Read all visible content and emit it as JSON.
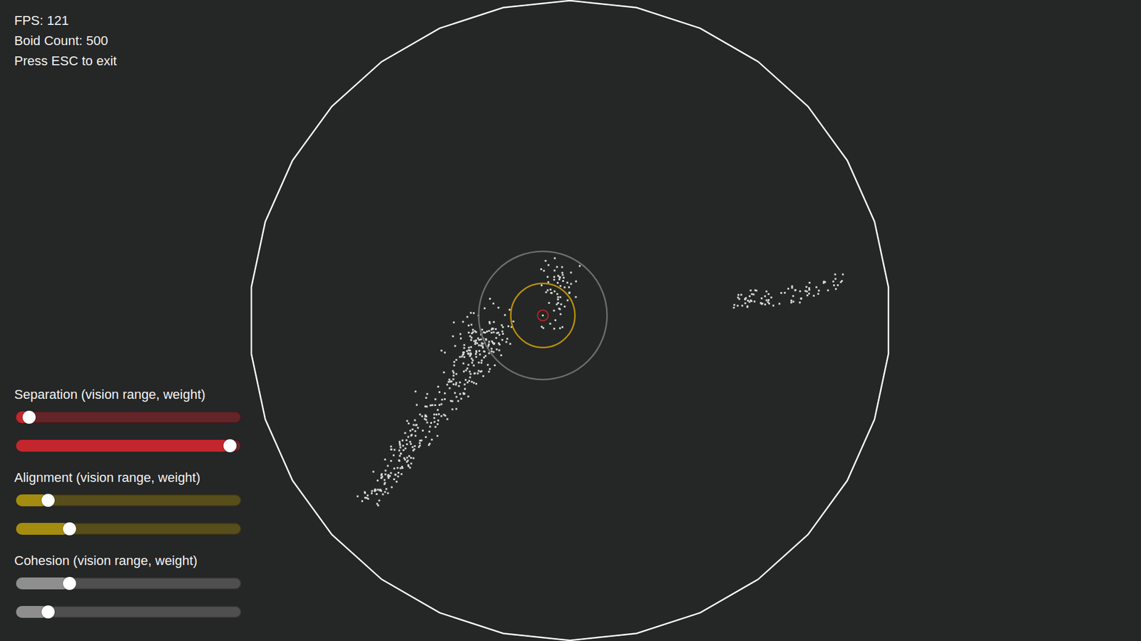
{
  "hud": {
    "fps": "FPS: 121",
    "boid_count": "Boid Count: 500",
    "hint": "Press ESC to exit"
  },
  "sliders": [
    {
      "label": "Separation (vision range, weight)",
      "color": "#c3262c",
      "controls": [
        {
          "level": 0.03
        },
        {
          "level": 0.97
        }
      ]
    },
    {
      "label": "Alignment (vision range, weight)",
      "color": "#a48c10",
      "controls": [
        {
          "level": 0.12
        },
        {
          "level": 0.22
        }
      ]
    },
    {
      "label": "Cohesion (vision range, weight)",
      "color": "#8e8e8e",
      "controls": [
        {
          "level": 0.22
        },
        {
          "level": 0.12
        }
      ]
    }
  ]
}
